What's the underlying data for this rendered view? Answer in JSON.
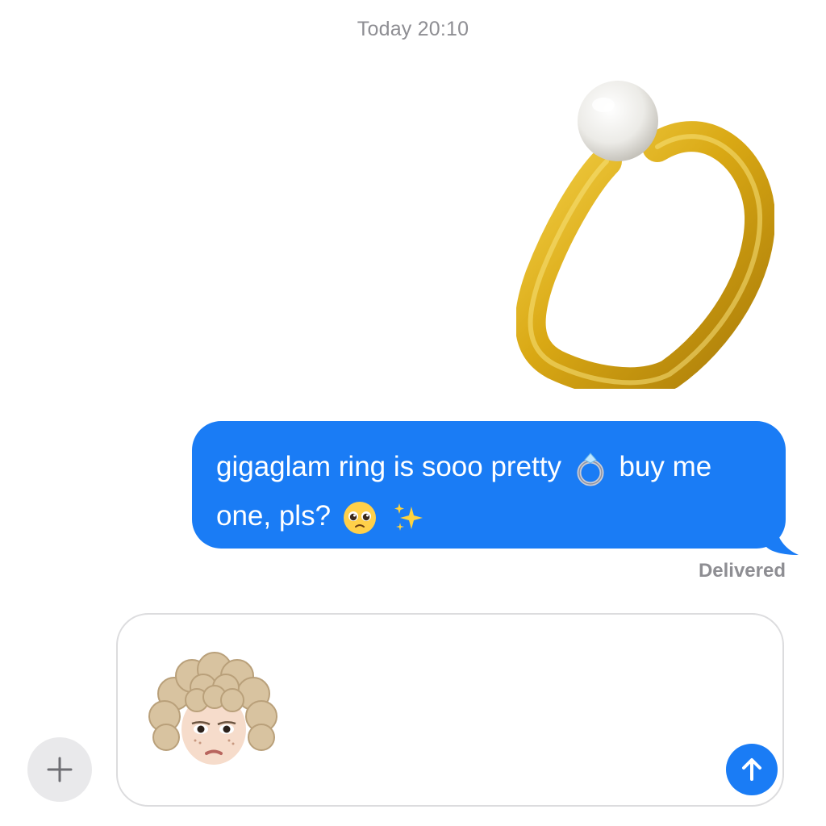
{
  "header": {
    "timestamp": "Today 20:10"
  },
  "thread": {
    "image_message": {
      "icon": "gold-pearl-ring-photo"
    },
    "message": {
      "text_part1": "gigaglam ring is sooo pretty",
      "text_part2": "buy me one, pls?",
      "emojis": [
        "ring-icon",
        "pleading-face-icon",
        "sparkles-icon"
      ],
      "bubble_color": "#1a7cf5"
    },
    "status": "Delivered"
  },
  "composer": {
    "attachment": {
      "icon": "memoji-sticker"
    },
    "plus_icon": "plus-icon",
    "send_icon": "arrow-up-icon"
  }
}
